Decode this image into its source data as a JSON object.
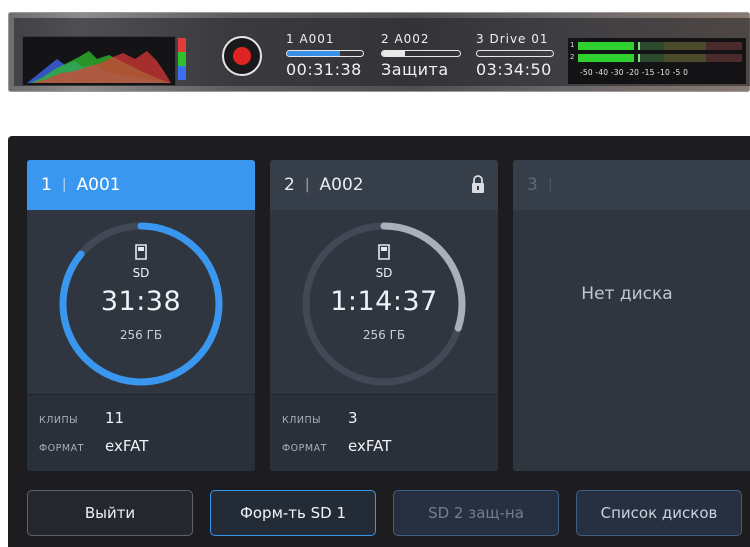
{
  "status_strip": {
    "record_button": "record",
    "histogram_colors": [
      "#e23b3b",
      "#2fbf2f",
      "#3b6ef0"
    ],
    "slots": [
      {
        "header": "1  A001",
        "value": "00:31:38",
        "fill": 0.7,
        "fill_color": "#3a8fe8"
      },
      {
        "header": "2  A002",
        "value": "Защита",
        "fill": 0.3,
        "fill_color": "#e8e8e8"
      },
      {
        "header": "3  Drive 01",
        "value": "03:34:50",
        "fill": 0.0,
        "fill_color": "#e8e8e8"
      }
    ],
    "audio_meters": {
      "channels": [
        "1",
        "2"
      ],
      "scale": "-50 -40  -30     -20  -15  -10   -5    0",
      "levels": [
        0.42,
        0.42
      ]
    }
  },
  "cards": [
    {
      "slot": "1",
      "name": "A001",
      "media": "SD",
      "time": "31:38",
      "capacity": "256 ГБ",
      "clips_label": "КЛИПЫ",
      "clips": "11",
      "format_label": "ФОРМАТ",
      "format": "exFAT",
      "used": 0.86,
      "ring_color": "#3a97f0",
      "locked": false
    },
    {
      "slot": "2",
      "name": "A002",
      "media": "SD",
      "time": "1:14:37",
      "capacity": "256 ГБ",
      "clips_label": "КЛИПЫ",
      "clips": "3",
      "format_label": "ФОРМАТ",
      "format": "exFAT",
      "used": 0.3,
      "ring_color": "#a9b0b9",
      "locked": true
    },
    {
      "slot": "3",
      "no_disk": "Нет диска"
    }
  ],
  "buttons": {
    "exit": "Выйти",
    "format": "Форм-ть SD 1",
    "protect": "SD 2 защ-на",
    "disk_list": "Список дисков"
  }
}
